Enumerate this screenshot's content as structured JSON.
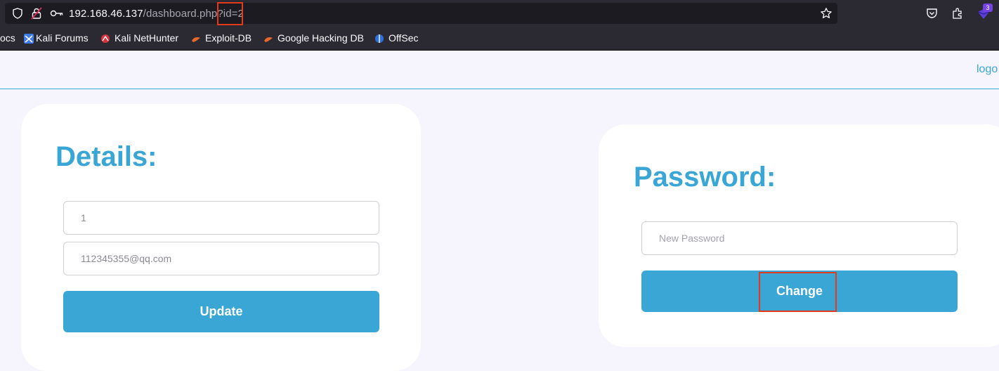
{
  "browser": {
    "url_host": "192.168.46.137",
    "url_path": "/dashboard.php",
    "url_query": "?id=2",
    "extension_badge_count": "3",
    "bookmarks": [
      {
        "label": "ocs"
      },
      {
        "label": "Kali Forums"
      },
      {
        "label": "Kali NetHunter"
      },
      {
        "label": "Exploit-DB"
      },
      {
        "label": "Google Hacking DB"
      },
      {
        "label": "OffSec"
      }
    ]
  },
  "header": {
    "logout_label": "logo"
  },
  "details": {
    "title": "Details:",
    "field1_value": "1",
    "field2_value": "112345355@qq.com",
    "update_label": "Update"
  },
  "password": {
    "title": "Password:",
    "new_password_placeholder": "New Password",
    "change_label": "Change"
  },
  "colors": {
    "accent": "#3aa6d5",
    "highlight": "#e23a1d",
    "page_background": "#f6f5fd"
  }
}
